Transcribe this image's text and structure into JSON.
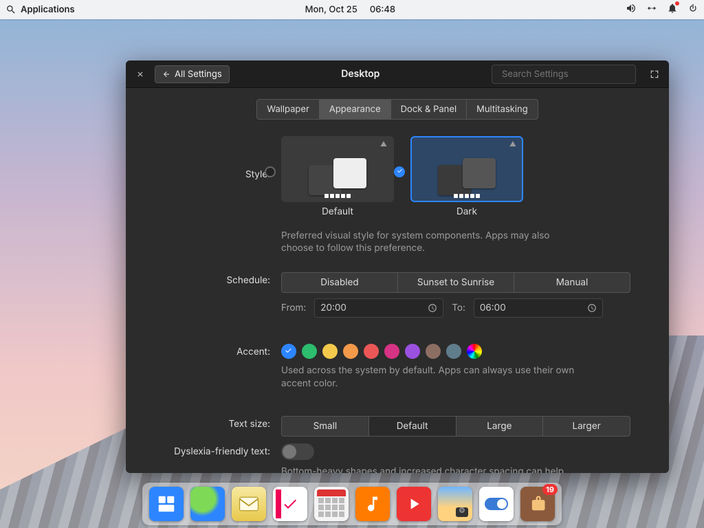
{
  "panel": {
    "applications": "Applications",
    "date": "Mon, Oct 25",
    "time": "06:48"
  },
  "window": {
    "back": "All Settings",
    "title": "Desktop",
    "search_placeholder": "Search Settings"
  },
  "tabs": [
    "Wallpaper",
    "Appearance",
    "Dock & Panel",
    "Multitasking"
  ],
  "style": {
    "label": "Style:",
    "options": [
      "Default",
      "Dark"
    ],
    "desc": "Preferred visual style for system components. Apps may also choose to follow this preference."
  },
  "schedule": {
    "label": "Schedule:",
    "options": [
      "Disabled",
      "Sunset to Sunrise",
      "Manual"
    ],
    "from_label": "From:",
    "from": "20:00",
    "to_label": "To:",
    "to": "06:00"
  },
  "accent": {
    "label": "Accent:",
    "colors": [
      "#2d86ff",
      "#2dbd6e",
      "#f2c94c",
      "#f2994a",
      "#eb5757",
      "#d63384",
      "#9b51e0",
      "#8d6e63",
      "#607d8b"
    ],
    "desc": "Used across the system by default. Apps can always use their own accent color."
  },
  "textsize": {
    "label": "Text size:",
    "options": [
      "Small",
      "Default",
      "Large",
      "Larger"
    ]
  },
  "dyslexia": {
    "label": "Dyslexia-friendly text:",
    "desc": "Bottom-heavy shapes and increased character spacing can help improve legibility and reading speed."
  },
  "dock": {
    "badge": "19"
  }
}
